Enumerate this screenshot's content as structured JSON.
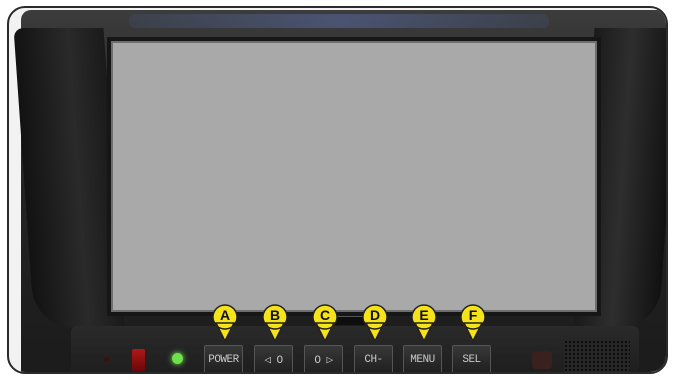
{
  "monitor": {
    "buttons": [
      {
        "id": "A",
        "label": "POWER"
      },
      {
        "id": "B",
        "label": "◁ O"
      },
      {
        "id": "C",
        "label": "O ▷"
      },
      {
        "id": "D",
        "label": "CH-"
      },
      {
        "id": "E",
        "label": "MENU"
      },
      {
        "id": "F",
        "label": "SEL"
      }
    ]
  },
  "colors": {
    "marker_fill": "#f5e21a",
    "power_led": "#6ee04a",
    "screen": "#a9a9a9"
  }
}
